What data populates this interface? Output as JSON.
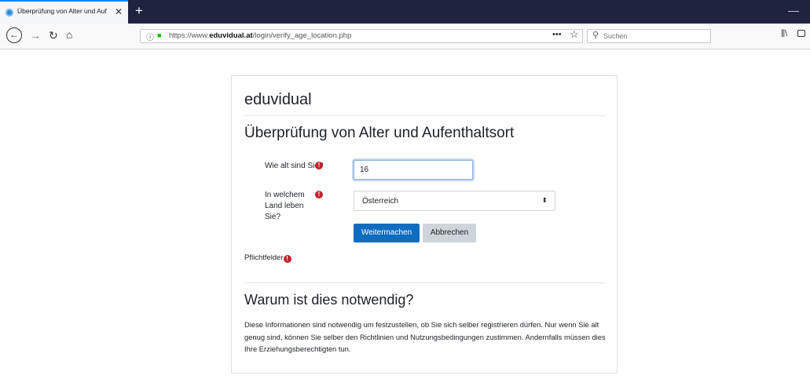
{
  "browser": {
    "tab_title": "Überprüfung von Alter und Auf",
    "tab_close": "✕",
    "new_tab": "+",
    "minimize": "—",
    "url_prefix": "https://www.",
    "url_domain": "eduvidual.at",
    "url_path": "/login/verify_age_location.php",
    "page_actions": "•••",
    "bookmark_star": "☆",
    "search_placeholder": "Suchen",
    "icons": [
      "back-icon",
      "forward-icon",
      "reload-icon",
      "home-icon",
      "info-icon",
      "lock-icon",
      "search-icon",
      "library-icon",
      "sidebar-icon"
    ]
  },
  "page": {
    "site_name": "eduvidual",
    "heading": "Überprüfung von Alter und Aufenthaltsort",
    "age_label": "Wie alt sind Sie?",
    "age_value": "16",
    "country_label": "In welchem Land leben Sie?",
    "country_value": "Österreich",
    "continue_button": "Weitermachen",
    "cancel_button": "Abbrechen",
    "required_fields": "Pflichtfelder",
    "why_heading": "Warum ist dies notwendig?",
    "why_text": "Diese Informationen sind notwendig um festzustellen, ob Sie sich selber registrieren dürfen. Nur wenn Sie alt genug sind, können Sie selber den Richtlinien und Nutzungsbedingungen zustimmen. Andernfalls müssen dies Ihre Erziehungsberechtigten tun.",
    "required_icon": "!"
  },
  "colors": {
    "tabbar": "#202340",
    "primary_button": "#0f6cbf",
    "required": "#c12330",
    "secure_lock": "#12bc00"
  }
}
